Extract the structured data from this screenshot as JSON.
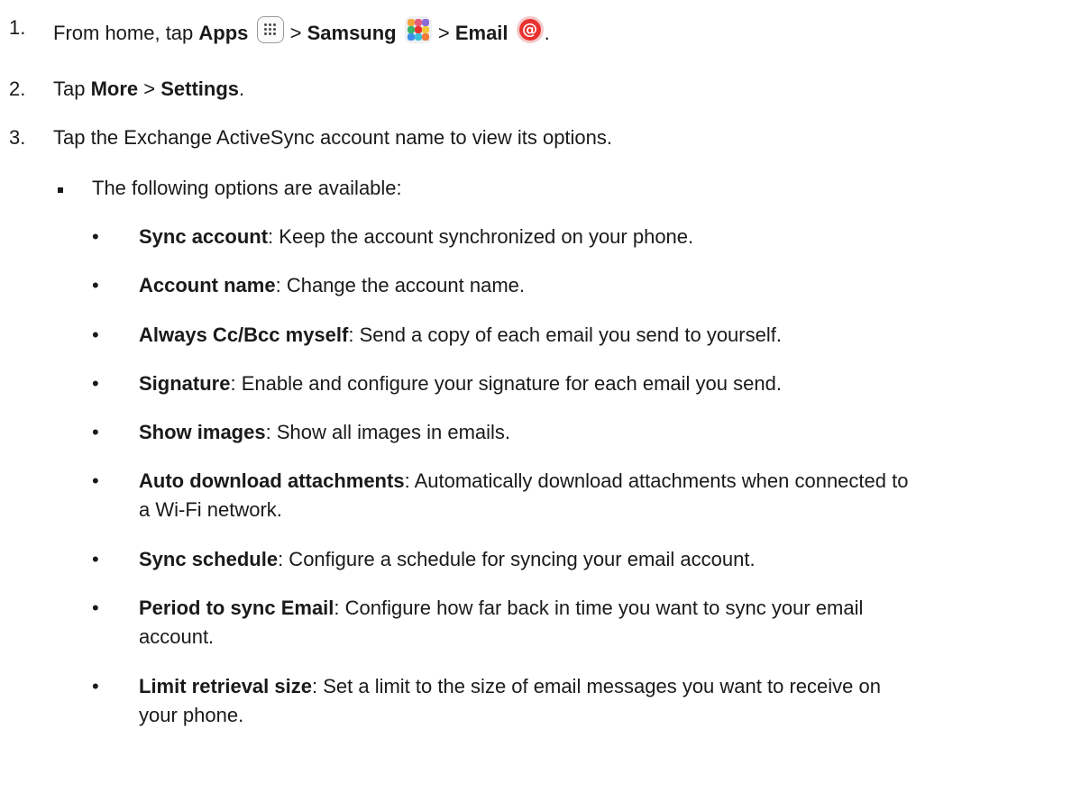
{
  "steps": [
    {
      "number": "1.",
      "prefix": "From home, tap ",
      "apps": "Apps",
      "sep1": " > ",
      "samsung": "Samsung",
      "sep2": " > ",
      "email": "Email",
      "end": "."
    },
    {
      "number": "2.",
      "prefix": "Tap ",
      "more": "More",
      "sep": " > ",
      "settings": "Settings",
      "end": "."
    },
    {
      "number": "3.",
      "text": "Tap the Exchange ActiveSync account name to view its options."
    }
  ],
  "intro": "The following options are available:",
  "bullet_glyph": "•",
  "options": [
    {
      "term": "Sync account",
      "desc": ": Keep the account synchronized on your phone."
    },
    {
      "term": "Account name",
      "desc": ": Change the account name."
    },
    {
      "term": "Always Cc/Bcc myself",
      "desc": ": Send a copy of each email you send to yourself."
    },
    {
      "term": "Signature",
      "desc": ": Enable and configure your signature for each email you send."
    },
    {
      "term": "Show images",
      "desc": ": Show all images in emails."
    },
    {
      "term": "Auto download attachments",
      "desc": ": Automatically download attachments when connected to",
      "desc2": "a Wi-Fi network."
    },
    {
      "term": "Sync schedule",
      "desc": ": Configure a schedule for syncing your email account."
    },
    {
      "term": "Period to sync Email",
      "desc": ": Configure how far back in time you want to sync your email",
      "desc2": "account."
    },
    {
      "term": "Limit retrieval size",
      "desc": ": Set a limit to the size of email messages you want to receive on",
      "desc2": "your phone."
    }
  ],
  "icons": {
    "apps": "apps-grid-icon",
    "samsung": "samsung-folder-icon",
    "email": "email-at-icon",
    "email_glyph": "@"
  },
  "colors": {
    "text": "#1a1a1a",
    "email_red": "#e8322f"
  }
}
